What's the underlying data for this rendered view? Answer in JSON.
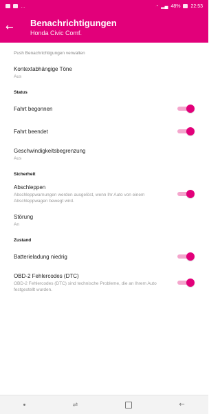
{
  "statusbar": {
    "time": "22:53",
    "battery": "48%"
  },
  "header": {
    "title": "Benachrichtigungen",
    "subtitle": "Honda Civic Comf."
  },
  "hint": "Push Benachrichtigungen verwalten",
  "items": {
    "kontext": {
      "title": "Kontextabhängige Töne",
      "sub": "Aus"
    },
    "status_label": "Status",
    "fahrt_begonnen": {
      "title": "Fahrt begonnen",
      "enabled": true
    },
    "fahrt_beendet": {
      "title": "Fahrt beendet",
      "enabled": true
    },
    "geschwindigkeit": {
      "title": "Geschwindigkeitsbegrenzung",
      "sub": "Aus"
    },
    "sicherheit_label": "Sicherheit",
    "abschleppen": {
      "title": "Abschleppen",
      "sub": "Abschleppwarnungen werden ausgelöst, wenn Ihr Auto von einem Abschleppwagen bewegt wird.",
      "enabled": true
    },
    "stoerung": {
      "title": "Störung",
      "sub": "An"
    },
    "zustand_label": "Zustand",
    "batterie": {
      "title": "Batterieladung niedrig",
      "enabled": true
    },
    "obd": {
      "title": "OBD-2 Fehlercodes (DTC)",
      "sub": "OBD-2 Fehlercodes (DTC) sind technische Probleme, die an Ihrem Auto festgestellt wurden.",
      "enabled": true
    }
  },
  "colors": {
    "accent": "#e2007a",
    "track": "#f4a6cd"
  }
}
